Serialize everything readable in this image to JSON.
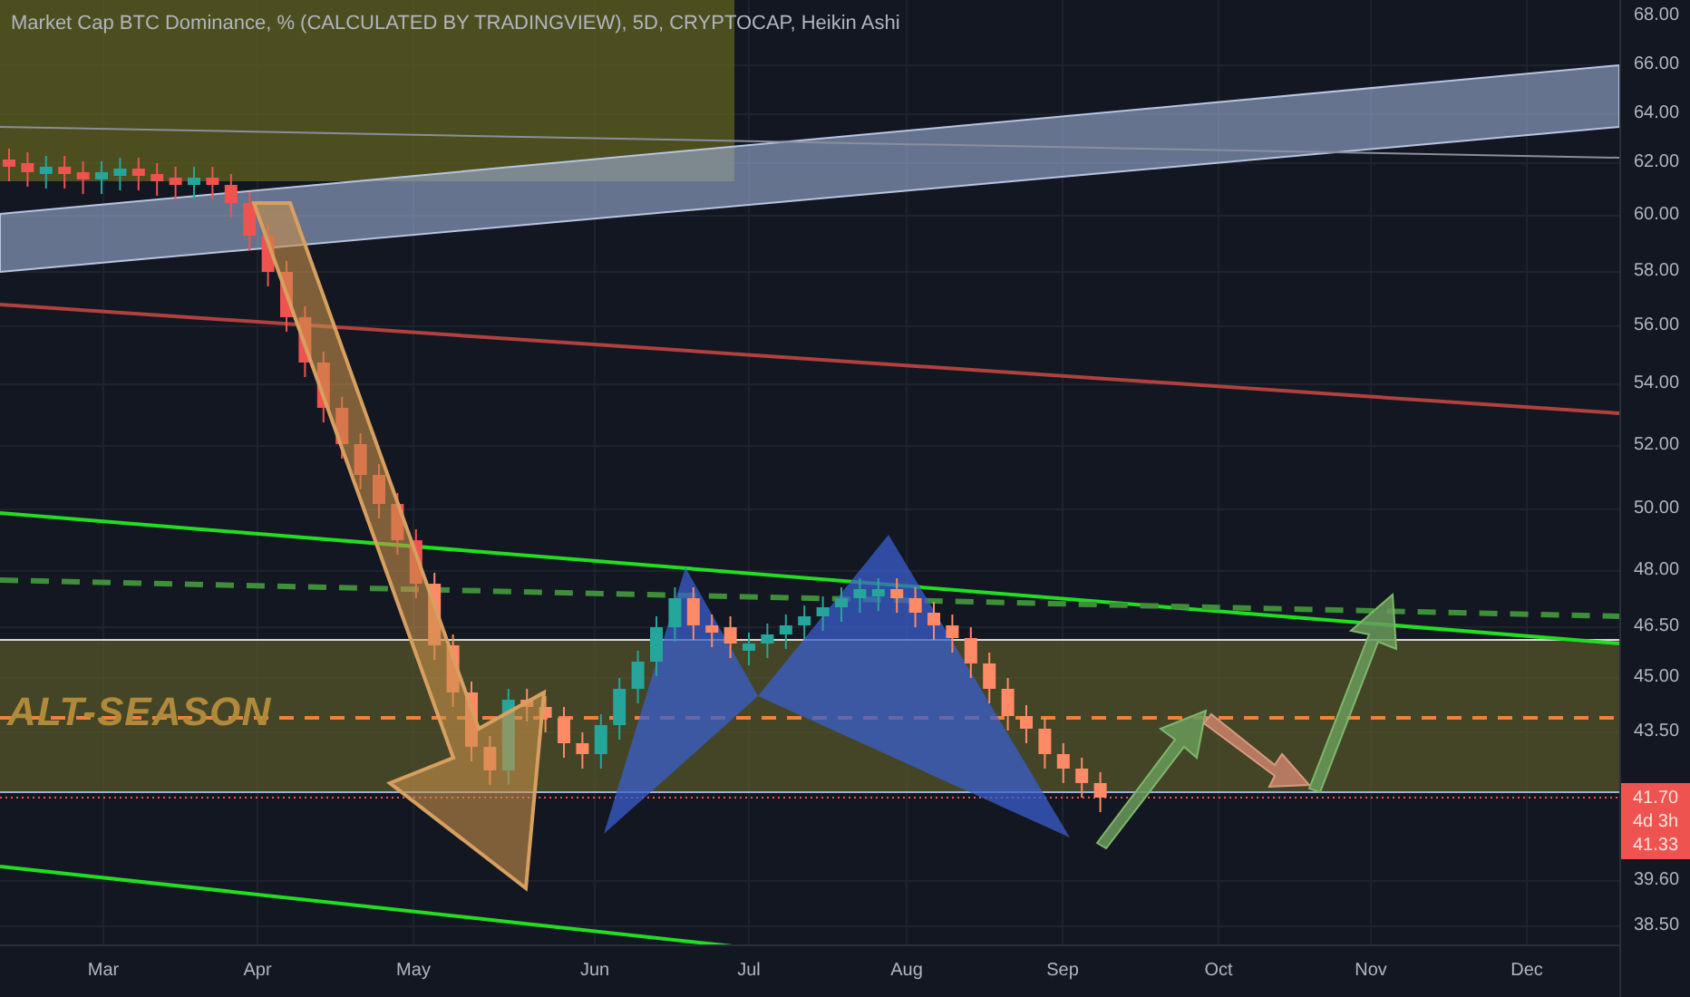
{
  "title": "Market Cap BTC Dominance, % (CALCULATED BY TRADINGVIEW), 5D, CRYPTOCAP, Heikin Ashi",
  "y_axis": {
    "ticks": [
      "68.00",
      "66.00",
      "64.00",
      "62.00",
      "60.00",
      "58.00",
      "56.00",
      "54.00",
      "52.00",
      "50.00",
      "48.00",
      "46.50",
      "45.00",
      "43.50",
      "39.60",
      "38.50"
    ]
  },
  "x_axis": {
    "ticks": [
      "Mar",
      "Apr",
      "May",
      "Jun",
      "Jul",
      "Aug",
      "Sep",
      "Oct",
      "Nov",
      "Dec"
    ]
  },
  "price_badge": {
    "price": "41.70",
    "countdown": "4d 3h",
    "previous_close": "41.33"
  },
  "annotation": {
    "label": "ALT-SEASON"
  }
}
